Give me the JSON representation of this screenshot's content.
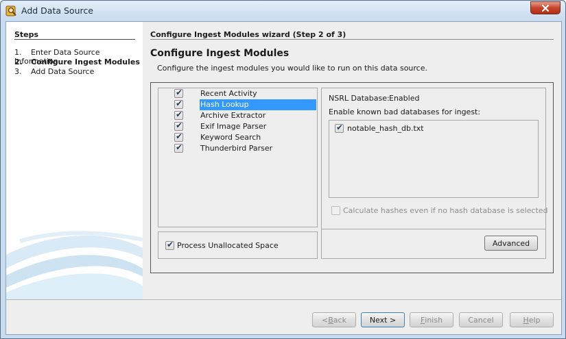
{
  "window": {
    "title": "Add Data Source",
    "icon": "magnifier-app-icon"
  },
  "steps": {
    "title": "Steps",
    "items": [
      {
        "num": "1.",
        "label": "Enter Data Source Information",
        "active": false
      },
      {
        "num": "2.",
        "label": "Configure Ingest Modules",
        "active": true
      },
      {
        "num": "3.",
        "label": "Add Data Source",
        "active": false
      }
    ]
  },
  "wizard": {
    "title": "Configure Ingest Modules wizard (Step 2 of 3)",
    "heading": "Configure Ingest Modules",
    "subtitle": "Configure the ingest modules you would like to run on this data source."
  },
  "modules": [
    {
      "label": "Recent Activity",
      "checked": true,
      "selected": false
    },
    {
      "label": "Hash Lookup",
      "checked": true,
      "selected": true
    },
    {
      "label": "Archive Extractor",
      "checked": true,
      "selected": false
    },
    {
      "label": "Exif Image Parser",
      "checked": true,
      "selected": false
    },
    {
      "label": "Keyword Search",
      "checked": true,
      "selected": false
    },
    {
      "label": "Thunderbird Parser",
      "checked": true,
      "selected": false
    }
  ],
  "unallocated": {
    "label": "Process Unallocated Space",
    "checked": true
  },
  "settings": {
    "nsrl_label": "NSRL Database:",
    "nsrl_value": "Enabled",
    "known_bad_label": "Enable known bad databases for ingest:",
    "databases": [
      {
        "name": "notable_hash_db.txt",
        "checked": true
      }
    ],
    "calc_label": "Calculate hashes even if no hash database is selected",
    "calc_checked": false,
    "advanced_label": "Advanced"
  },
  "buttons": {
    "back": {
      "prefix": "< ",
      "mnemonic": "B",
      "rest": "ack"
    },
    "next": "Next >",
    "finish": {
      "mnemonic": "F",
      "rest": "inish"
    },
    "cancel": "Cancel",
    "help": {
      "mnemonic": "H",
      "rest": "elp"
    }
  },
  "colors": {
    "selection": "#3399ff",
    "title_bar": "#c8dbef",
    "close_button": "#c6442d"
  }
}
